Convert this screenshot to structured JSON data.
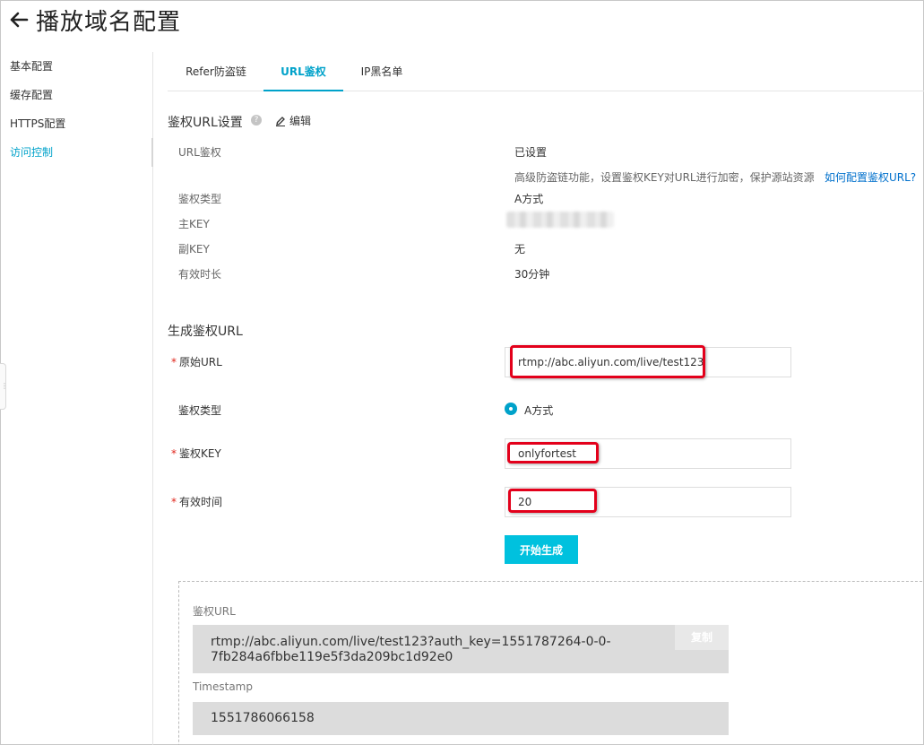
{
  "header": {
    "title": "播放域名配置"
  },
  "sidebar": {
    "items": [
      {
        "label": "基本配置"
      },
      {
        "label": "缓存配置"
      },
      {
        "label": "HTTPS配置"
      },
      {
        "label": "访问控制"
      }
    ],
    "active_index": 3
  },
  "tabs": [
    {
      "label": "Refer防盗链"
    },
    {
      "label": "URL鉴权"
    },
    {
      "label": "IP黑名单"
    }
  ],
  "auth_settings": {
    "title": "鉴权URL设置",
    "edit_label": "编辑",
    "rows": {
      "url_auth": {
        "label": "URL鉴权",
        "value": "已设置"
      },
      "hint": "高级防盗链功能，设置鉴权KEY对URL进行加密，保护源站资源",
      "help_link": "如何配置鉴权URL?",
      "auth_type": {
        "label": "鉴权类型",
        "value": "A方式"
      },
      "primary_key": {
        "label": "主KEY"
      },
      "secondary_key": {
        "label": "副KEY",
        "value": "无"
      },
      "validity": {
        "label": "有效时长",
        "value": "30分钟"
      }
    }
  },
  "generate": {
    "title": "生成鉴权URL",
    "original_url": {
      "label": "原始URL",
      "value": "rtmp://abc.aliyun.com/live/test123"
    },
    "auth_type": {
      "label": "鉴权类型",
      "option": "A方式"
    },
    "auth_key": {
      "label": "鉴权KEY",
      "value": "onlyfortest"
    },
    "valid_time": {
      "label": "有效时间",
      "value": "20"
    },
    "button_label": "开始生成"
  },
  "result": {
    "url_label": "鉴权URL",
    "url_value_line1": "rtmp://abc.aliyun.com/live/test123?auth_key=1551787264-0-0-",
    "url_value_line2": "7fb284a6fbbe119e5f3da209bc1d92e0",
    "copy_label": "复制",
    "timestamp_label": "Timestamp",
    "timestamp_value": "1551786066158"
  },
  "colors": {
    "accent": "#00a2ca",
    "button": "#00c1de",
    "highlight": "#e3001b",
    "link": "#0070cc"
  }
}
